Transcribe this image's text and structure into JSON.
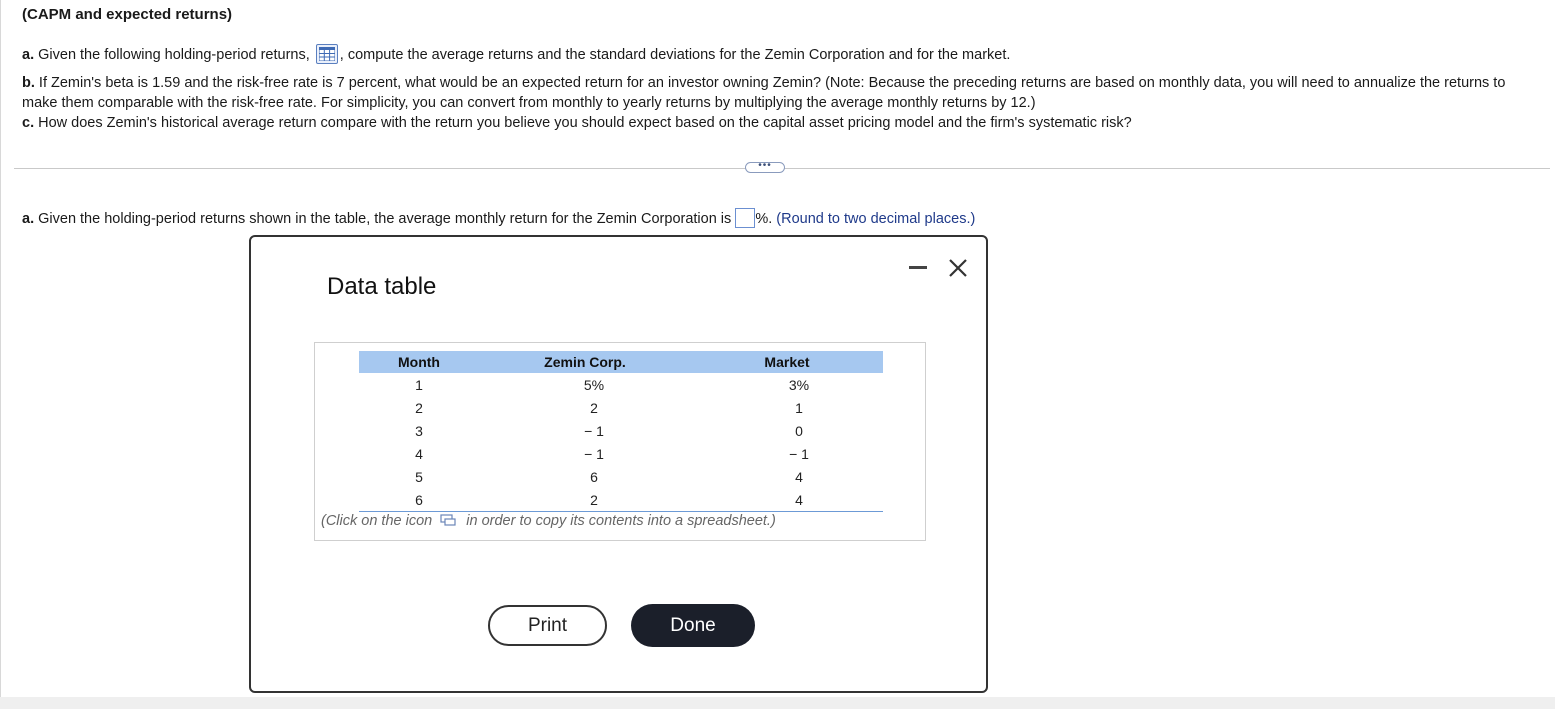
{
  "problem": {
    "title": "(CAPM and expected returns)",
    "part_a": {
      "letter": "a.",
      "text_before_icon": "Given the following holding-period returns,",
      "text_after_icon": ", compute the average returns and the standard deviations for the Zemin Corporation and for the market."
    },
    "part_b": {
      "letter": "b.",
      "text": "If Zemin's beta is 1.59 and the risk-free rate is 7 percent, what would be an expected return for an investor owning Zemin? (Note: Because the preceding returns are based on monthly data, you will need to annualize the returns to make them comparable with the risk-free rate.  For simplicity, you can convert from monthly to yearly returns by multiplying the average monthly returns by 12.)"
    },
    "part_c": {
      "letter": "c.",
      "text": "How does Zemin's historical average return compare with the return you believe you should expect based on the capital asset pricing model and the firm's systematic risk?"
    }
  },
  "more_button_label": "•••",
  "answer": {
    "letter": "a.",
    "text": "Given the holding-period returns shown in the table, the average monthly return for the Zemin Corporation is",
    "input_value": "",
    "suffix": "%.",
    "hint": "(Round to two decimal places.)"
  },
  "dialog": {
    "title": "Data table",
    "table": {
      "headers": [
        "Month",
        "Zemin Corp.",
        "Market"
      ],
      "rows": [
        [
          "1",
          "5%",
          "3%"
        ],
        [
          "2",
          "2",
          "1"
        ],
        [
          "3",
          "− 1",
          "0"
        ],
        [
          "4",
          "− 1",
          "− 1"
        ],
        [
          "5",
          "6",
          "4"
        ],
        [
          "6",
          "2",
          "4"
        ]
      ]
    },
    "copy_note_before": "(Click on the icon",
    "copy_note_after": "in order to copy its contents into a spreadsheet.)",
    "print_label": "Print",
    "done_label": "Done"
  },
  "icons": {
    "data_table": "grid-icon",
    "copy": "copy-icon",
    "minimize": "minimize-icon",
    "close": "close-icon"
  }
}
